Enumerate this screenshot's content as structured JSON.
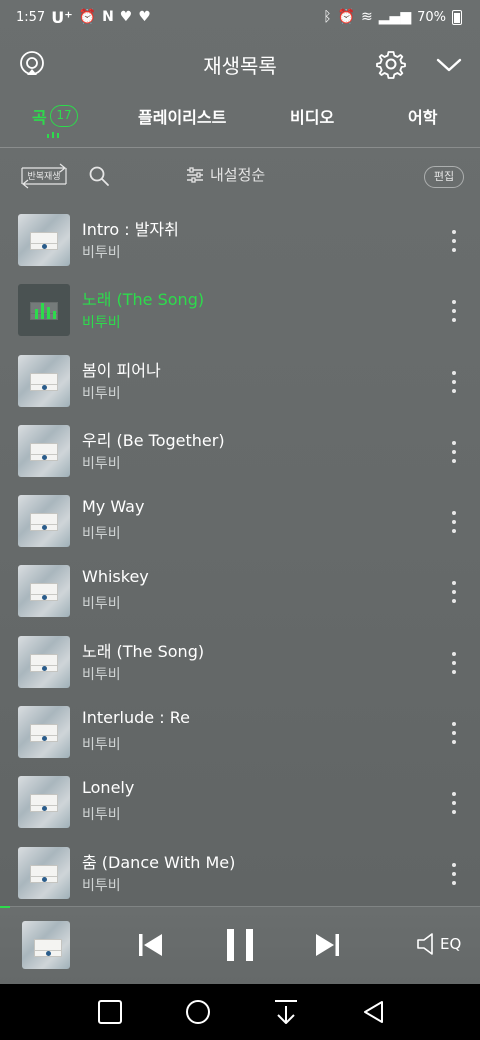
{
  "status_bar": {
    "time": "1:57",
    "carrier": "U⁺",
    "left_icons": [
      "alarm-clock-icon",
      "nate-icon",
      "heart-icon",
      "heart-icon"
    ],
    "battery": "70%"
  },
  "header": {
    "title": "재생목록",
    "icons": [
      "cast-icon",
      "gear-icon",
      "chevron-down-icon"
    ]
  },
  "tabs": [
    {
      "label": "곡",
      "count": "17",
      "active": true
    },
    {
      "label": "플레이리스트",
      "active": false
    },
    {
      "label": "비디오",
      "active": false
    },
    {
      "label": "어학",
      "active": false
    }
  ],
  "toolbar": {
    "repeat_label": "반복재생",
    "sort_label": "내설정순",
    "edit_label": "편집"
  },
  "songs": [
    {
      "title": "Intro : 발자취",
      "artist": "비투비",
      "playing": false
    },
    {
      "title": "노래 (The Song)",
      "artist": "비투비",
      "playing": true
    },
    {
      "title": "봄이 피어나",
      "artist": "비투비",
      "playing": false
    },
    {
      "title": "우리 (Be Together)",
      "artist": "비투비",
      "playing": false
    },
    {
      "title": "My Way",
      "artist": "비투비",
      "playing": false
    },
    {
      "title": "Whiskey",
      "artist": "비투비",
      "playing": false
    },
    {
      "title": "노래 (The Song)",
      "artist": "비투비",
      "playing": false
    },
    {
      "title": "Interlude : Re",
      "artist": "비투비",
      "playing": false
    },
    {
      "title": "Lonely",
      "artist": "비투비",
      "playing": false
    },
    {
      "title": "춤 (Dance With Me)",
      "artist": "비투비",
      "playing": false
    }
  ],
  "player": {
    "eq_label": "EQ",
    "progress": 0.02,
    "state": "playing"
  },
  "colors": {
    "accent": "#2ddb4c",
    "background": "#676b6b",
    "nav_bar": "#000000"
  }
}
